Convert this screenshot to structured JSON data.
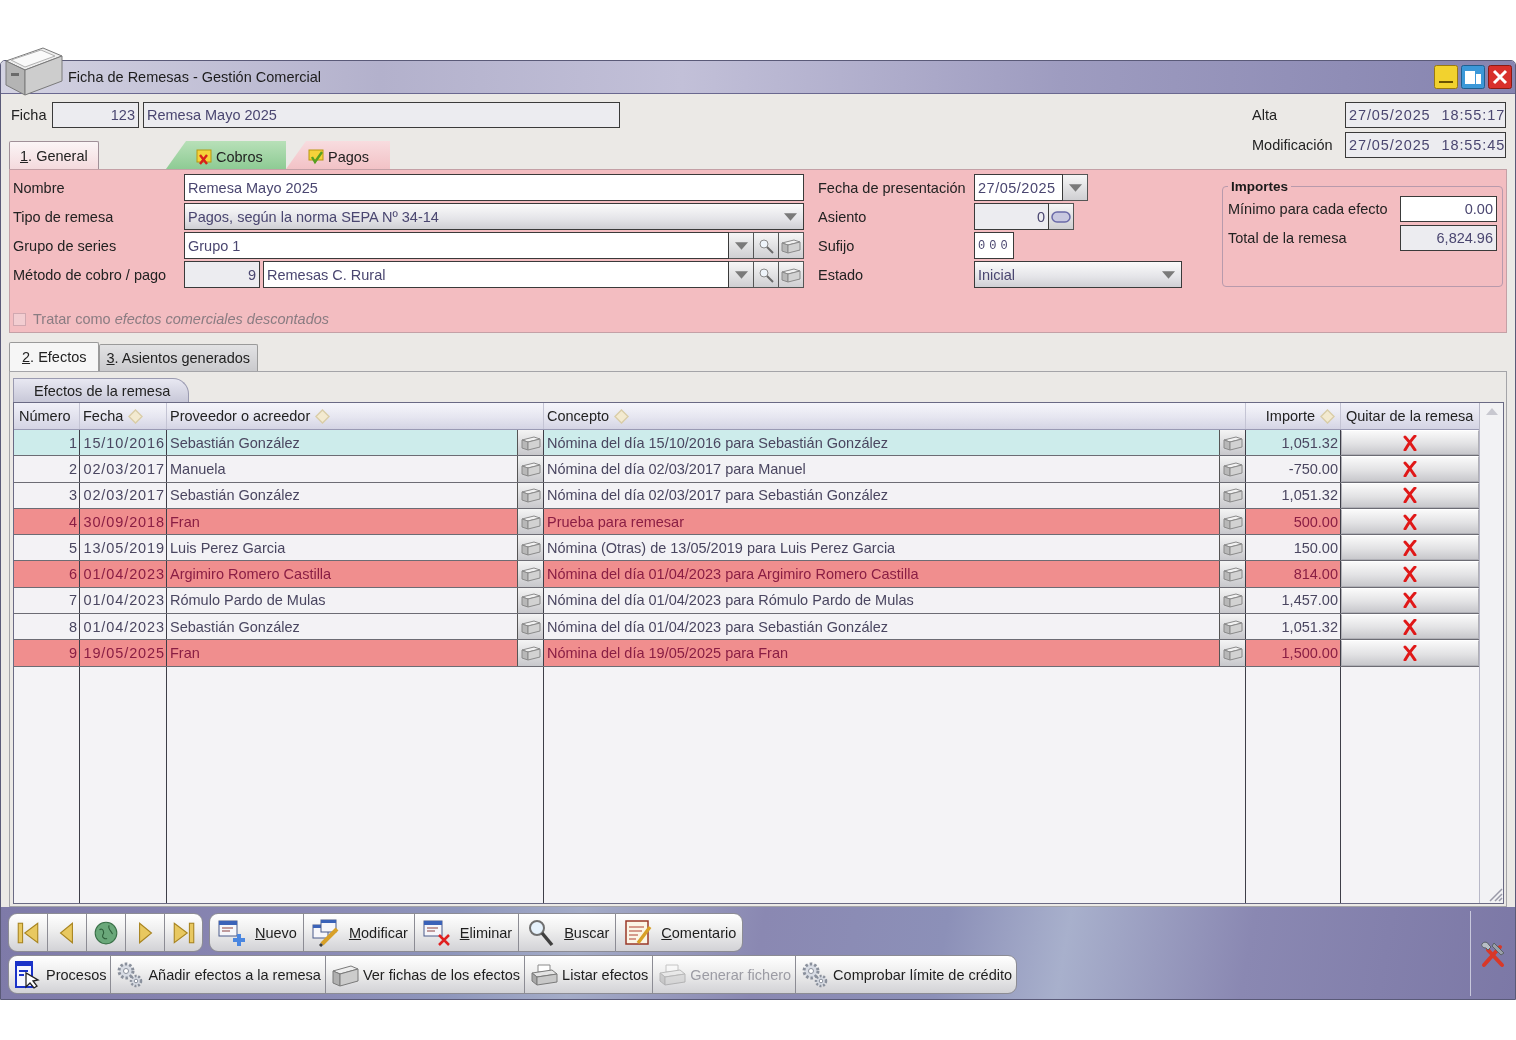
{
  "window": {
    "title": "Ficha de Remesas - Gestión Comercial"
  },
  "header": {
    "ficha_label": "Ficha",
    "number": "123",
    "name": "Remesa Mayo 2025",
    "alta_label": "Alta",
    "alta_value": "27/05/2025 18:55:17",
    "modificacion_label": "Modificación",
    "modificacion_value": "27/05/2025 18:55:45"
  },
  "main_tabs": [
    {
      "label": "1. General",
      "selected": true,
      "underlined_key": true
    }
  ],
  "type_tabs": [
    {
      "label": "Cobros",
      "kind": "cross",
      "selected": false
    },
    {
      "label": "Pagos",
      "kind": "tick",
      "selected": true
    }
  ],
  "general": {
    "nombre": {
      "label": "Nombre",
      "value": "Remesa Mayo 2025"
    },
    "tipo_remesa": {
      "label": "Tipo de remesa",
      "value": "Pagos, según la norma SEPA Nº 34-14"
    },
    "grupo_series": {
      "label": "Grupo de series",
      "value": "Grupo 1"
    },
    "metodo": {
      "label": "Método de cobro / pago",
      "code": "9",
      "value": "Remesas C. Rural"
    },
    "fecha_presentacion": {
      "label": "Fecha de presentación",
      "value": "27/05/2025"
    },
    "asiento": {
      "label": "Asiento",
      "value": "0"
    },
    "sufijo": {
      "label": "Sufijo",
      "value": "000"
    },
    "estado": {
      "label": "Estado",
      "value": "Inicial"
    },
    "importes": {
      "title": "Importes",
      "minimo": {
        "label": "Mínimo para cada efecto",
        "value": "0.00"
      },
      "total": {
        "label": "Total de la remesa",
        "value": "6,824.96"
      }
    },
    "descontados": {
      "label": "Tratar como *efectos comerciales descontados*",
      "checked": false,
      "disabled": true
    }
  },
  "effects_tabs": [
    {
      "label": "2. Efectos",
      "selected": true,
      "underlined_key": true
    },
    {
      "label": "3. Asientos generados",
      "selected": false,
      "underlined_key": true
    }
  ],
  "effects": {
    "tab": {
      "label": "Efectos de la remesa",
      "selected": true
    },
    "columns": [
      {
        "label": "Número",
        "sortable": false
      },
      {
        "label": "Fecha",
        "sortable": true
      },
      {
        "label": "Proveedor o acreedor",
        "sortable": true
      },
      {
        "label": "Concepto",
        "sortable": true
      },
      {
        "label": "Importe",
        "sortable": true
      },
      {
        "label": "Quitar de la remesa",
        "sortable": false
      }
    ],
    "rows": [
      {
        "numero": "1",
        "fecha": "15/10/2016",
        "proveedor": "Sebastián González",
        "concepto": "Nómina del día 15/10/2016 para Sebastián González",
        "importe": "1,051.32",
        "selected": true,
        "highlighted": false
      },
      {
        "numero": "2",
        "fecha": "02/03/2017",
        "proveedor": "Manuela",
        "concepto": "Nómina del día 02/03/2017 para Manuel",
        "importe": "-750.00",
        "selected": false,
        "highlighted": false
      },
      {
        "numero": "3",
        "fecha": "02/03/2017",
        "proveedor": "Sebastián González",
        "concepto": "Nómina del día 02/03/2017 para Sebastián González",
        "importe": "1,051.32",
        "selected": false,
        "highlighted": false
      },
      {
        "numero": "4",
        "fecha": "30/09/2018",
        "proveedor": "Fran",
        "concepto": "Prueba para remesar",
        "importe": "500.00",
        "selected": false,
        "highlighted": true
      },
      {
        "numero": "5",
        "fecha": "13/05/2019",
        "proveedor": "Luis Perez Garcia",
        "concepto": "Nómina (Otras) de 13/05/2019 para Luis Perez Garcia",
        "importe": "150.00",
        "selected": false,
        "highlighted": false
      },
      {
        "numero": "6",
        "fecha": "01/04/2023",
        "proveedor": "Argimiro Romero Castilla",
        "concepto": "Nómina del día 01/04/2023 para Argimiro Romero Castilla",
        "importe": "814.00",
        "selected": false,
        "highlighted": true
      },
      {
        "numero": "7",
        "fecha": "01/04/2023",
        "proveedor": "Rómulo Pardo de Mulas",
        "concepto": "Nómina del día 01/04/2023 para Rómulo Pardo de Mulas",
        "importe": "1,457.00",
        "selected": false,
        "highlighted": false
      },
      {
        "numero": "8",
        "fecha": "01/04/2023",
        "proveedor": "Sebastián González",
        "concepto": "Nómina del día 01/04/2023 para Sebastián González",
        "importe": "1,051.32",
        "selected": false,
        "highlighted": false
      },
      {
        "numero": "9",
        "fecha": "19/05/2025",
        "proveedor": "Fran",
        "concepto": "Nómina del día 19/05/2025 para Fran",
        "importe": "1,500.00",
        "selected": false,
        "highlighted": true
      }
    ]
  },
  "toolbar": {
    "primary": [
      {
        "label": "Nuevo",
        "kind": "new",
        "underlined_key": true
      },
      {
        "label": "Modificar",
        "kind": "edit",
        "underlined_key": true
      },
      {
        "label": "Eliminar",
        "kind": "delete",
        "underlined_key": true
      },
      {
        "label": "Buscar",
        "kind": "search",
        "underlined_key": true
      },
      {
        "label": "Comentario",
        "kind": "comment",
        "underlined_key": true
      }
    ],
    "secondary": [
      {
        "label": "Procesos",
        "kind": "processes",
        "disabled": false
      },
      {
        "label": "Añadir efectos a la remesa",
        "kind": "gears",
        "disabled": false
      },
      {
        "label": "Ver fichas de los efectos",
        "kind": "cabinet",
        "disabled": false
      },
      {
        "label": "Listar efectos",
        "kind": "printer",
        "disabled": false
      },
      {
        "label": "Generar fichero",
        "kind": "printer",
        "disabled": true
      },
      {
        "label": "Comprobar límite de crédito",
        "kind": "gears",
        "disabled": false
      }
    ]
  }
}
